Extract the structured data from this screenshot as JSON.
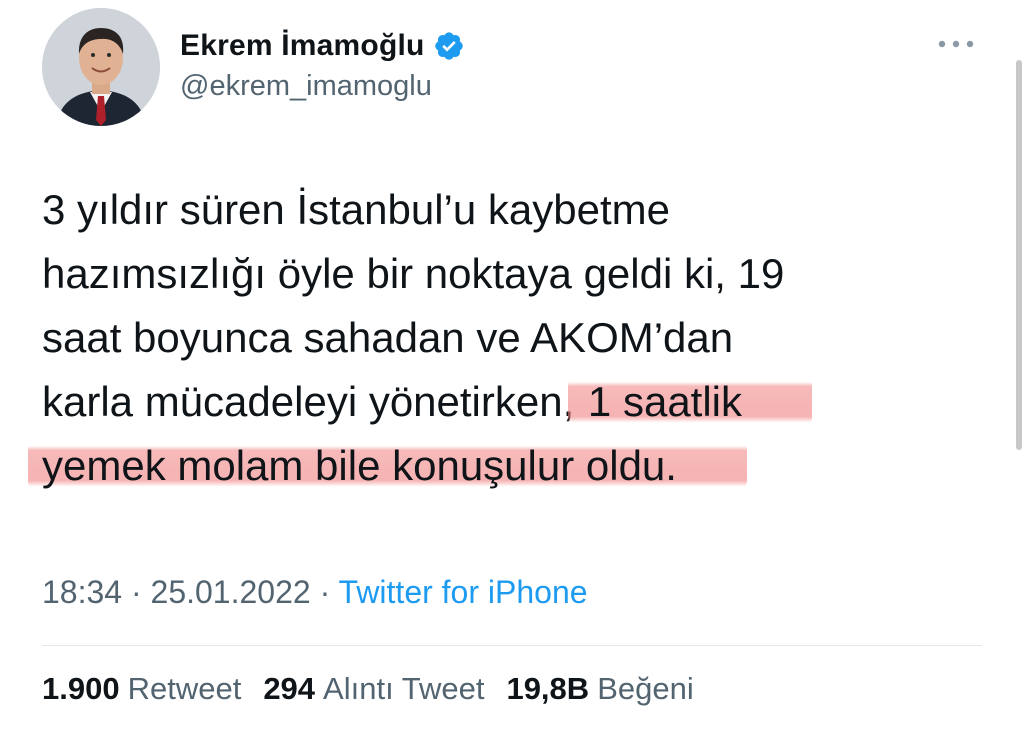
{
  "author": {
    "display_name": "Ekrem İmamoğlu",
    "handle": "@ekrem_imamoglu",
    "avatar_icon": "profile-photo",
    "verified_icon": "verified-badge-icon",
    "verified_color": "#1d9bf0"
  },
  "more_icon": "more-dots-icon",
  "tweet": {
    "lines": [
      "3 yıldır süren İstanbul’u kaybetme",
      "hazımsızlığı öyle bir noktaya geldi ki, 19",
      "saat boyunca sahadan ve AKOM’dan",
      "karla mücadeleyi yönetirken,",
      "yemek molam bile konuşulur oldu."
    ],
    "line4_highlight": " 1 saatlik",
    "highlight_color": "#f08080"
  },
  "meta": {
    "time": "18:34",
    "separator": " · ",
    "date": "25.01.2022",
    "source": "Twitter for iPhone",
    "source_color": "#1d9bf0"
  },
  "stats": {
    "retweets_count": "1.900",
    "retweets_label": "Retweet",
    "quotes_count": "294",
    "quotes_label": "Alıntı Tweet",
    "likes_count": "19,8B",
    "likes_label": "Beğeni"
  }
}
